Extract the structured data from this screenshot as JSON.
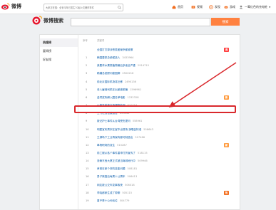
{
  "topbar": {
    "logo_text": "微博",
    "search_placeholder": "大家正在搜：全省今年已发生70起火灾爆炸事件",
    "nav": [
      {
        "label": "首页",
        "icon": "home-icon"
      },
      {
        "label": "视频",
        "icon": "video-icon"
      },
      {
        "label": "发现",
        "icon": "discover-icon"
      },
      {
        "label": "游戏",
        "icon": "game-icon"
      }
    ],
    "user_name": "一辈红色的充电桩"
  },
  "search": {
    "title": "微博搜索",
    "query": "",
    "button_label": "搜索"
  },
  "sidebar": {
    "items": [
      {
        "label": "热搜榜",
        "active": true
      },
      {
        "label": "要闻榜",
        "active": false
      },
      {
        "label": "好友搜",
        "active": false
      }
    ]
  },
  "table": {
    "head_rank": "序号",
    "head_keyword": "关键词",
    "rows": [
      {
        "rank": "",
        "keyword": "全国打打掉涉恶类团案杀都被擦",
        "count": "",
        "badge": "沸"
      },
      {
        "rank": "1",
        "keyword": "韩国要抓总统候选人",
        "count": "3433964",
        "badge": ""
      },
      {
        "rank": "2",
        "keyword": "美要求水果类植物最后多者全严重",
        "count": "2914715",
        "badge": ""
      },
      {
        "rank": "3",
        "keyword": "韩嫌总统顾问被国脚",
        "count": "2500216",
        "badge": ""
      },
      {
        "rank": "4",
        "keyword": "前北京国际机场将迁移",
        "count": "2490136",
        "badge": ""
      },
      {
        "rank": "5",
        "keyword": "老人雇佣司机在出差被欺骗",
        "count": "1596961",
        "badge": ""
      },
      {
        "rank": "6",
        "keyword": "金项奖所解入围名单电影",
        "count": "1232328",
        "badge": "新"
      },
      {
        "rank": "7",
        "keyword": "火箭发射被当场漏物检测",
        "count": "810716",
        "badge": ""
      },
      {
        "rank": "8",
        "keyword": "王书记的官被罢官",
        "count": "653444",
        "badge": ""
      },
      {
        "rank": "9",
        "keyword": "被记护士事件从台湾受伤提问",
        "count": "558961",
        "badge": ""
      },
      {
        "rank": "10",
        "keyword": "明星宣布周末在宝华出现场 演唱会特准",
        "count": "558643",
        "badge": ""
      },
      {
        "rank": "11",
        "keyword": "王源场下工业再保有都可制造出",
        "count": "517466",
        "badge": ""
      },
      {
        "rank": "12",
        "keyword": "奉杨职场的变生",
        "count": "515287",
        "badge": "新"
      },
      {
        "rank": "13",
        "keyword": "前工服从各个事件重申打折宣传了",
        "count": "518115",
        "badge": ""
      },
      {
        "rank": "14",
        "keyword": "浙黄东西大厦正式被当商城地行中",
        "count": "509946",
        "badge": ""
      },
      {
        "rank": "15",
        "keyword": "养育在家个好的技能问题",
        "count": "508181",
        "badge": ""
      },
      {
        "rank": "16",
        "keyword": "男子离高后每周十公周年",
        "count": "506413",
        "badge": ""
      },
      {
        "rank": "17",
        "keyword": "网友被公交车变事故夜",
        "count": "506018",
        "badge": ""
      },
      {
        "rank": "18",
        "keyword": "李晓都家生成了带聊",
        "count": "505115",
        "badge": "热"
      },
      {
        "rank": "19",
        "keyword": "喜乎哥十公司也位",
        "count": "504779",
        "badge": ""
      }
    ]
  },
  "colors": {
    "brand_orange": "#ff8140",
    "link_blue": "#0a5dab",
    "annotation_red": "#d9282c"
  }
}
